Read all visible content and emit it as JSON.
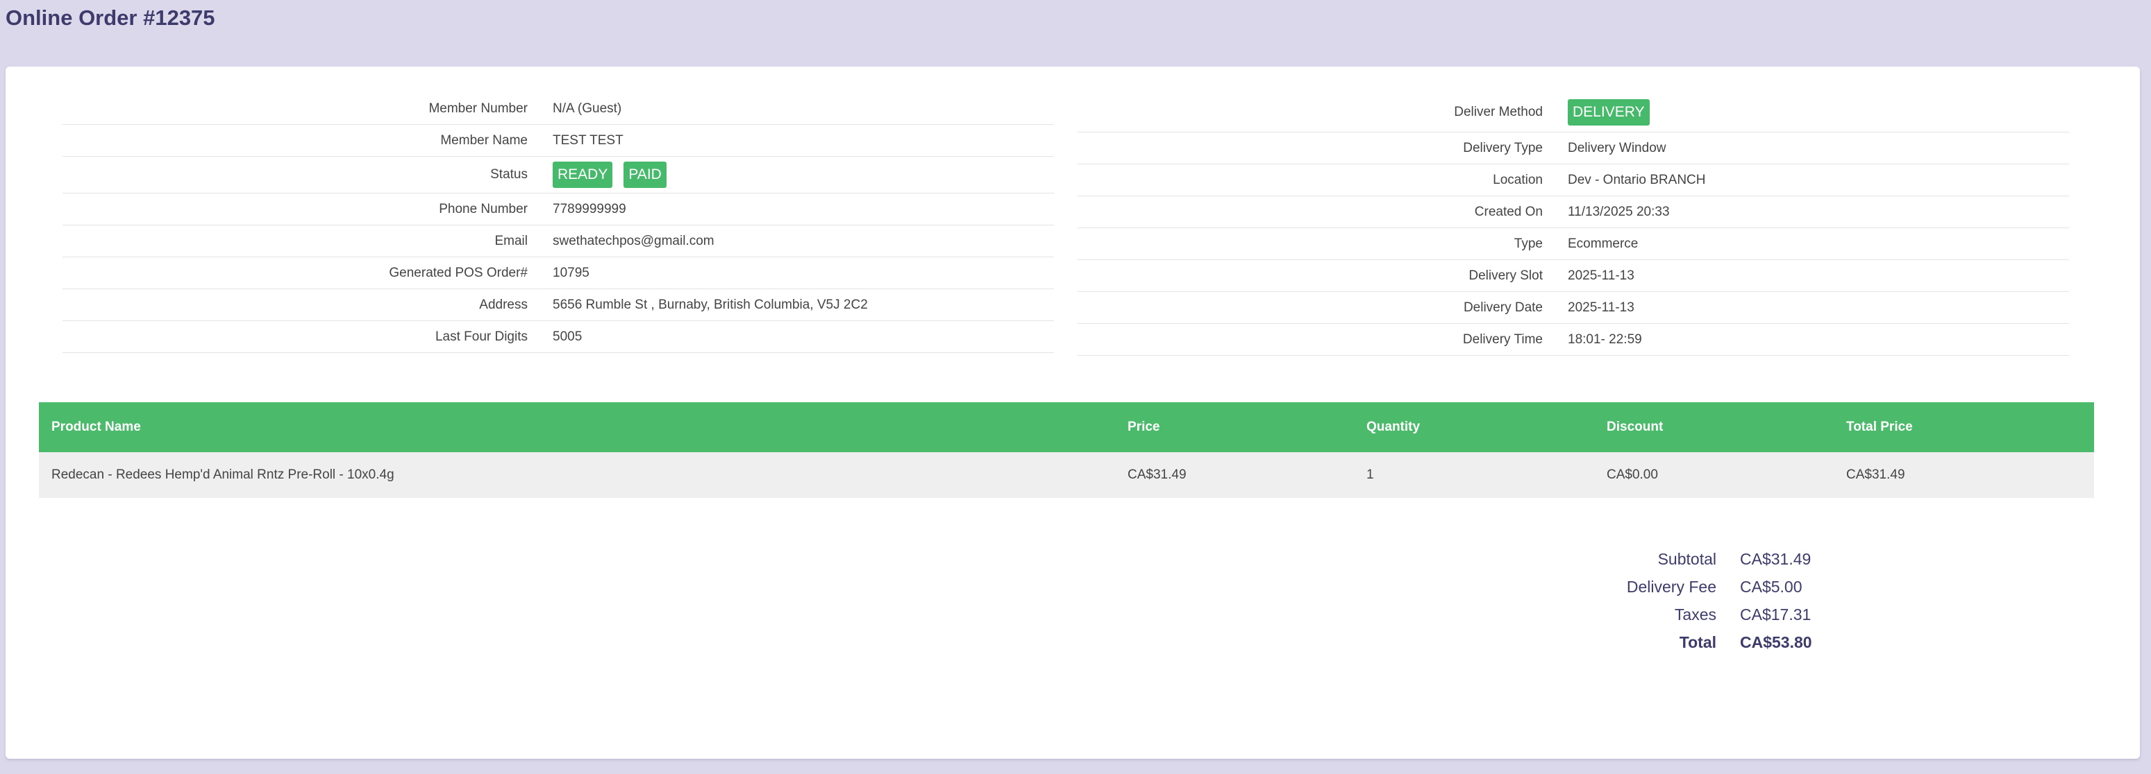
{
  "page": {
    "title": "Online Order #12375"
  },
  "left_info": [
    {
      "label": "Member Number",
      "value": "N/A (Guest)"
    },
    {
      "label": "Member Name",
      "value": "TEST TEST"
    },
    {
      "label": "Status",
      "badges": [
        "READY",
        "PAID"
      ]
    },
    {
      "label": "Phone Number",
      "value": "7789999999"
    },
    {
      "label": "Email",
      "value": "swethatechpos@gmail.com"
    },
    {
      "label": "Generated POS Order#",
      "value": "10795"
    },
    {
      "label": "Address",
      "value": "5656 Rumble St , Burnaby, British Columbia, V5J 2C2"
    },
    {
      "label": "Last Four Digits",
      "value": "5005"
    }
  ],
  "right_info": [
    {
      "label": "Deliver Method",
      "badge": "DELIVERY"
    },
    {
      "label": "Delivery Type",
      "value": "Delivery Window"
    },
    {
      "label": "Location",
      "value": "Dev - Ontario BRANCH"
    },
    {
      "label": "Created On",
      "value": "11/13/2025 20:33"
    },
    {
      "label": "Type",
      "value": "Ecommerce"
    },
    {
      "label": "Delivery Slot",
      "value": "2025-11-13"
    },
    {
      "label": "Delivery Date",
      "value": "2025-11-13"
    },
    {
      "label": "Delivery Time",
      "value": "18:01- 22:59"
    }
  ],
  "items_table": {
    "headers": [
      "Product Name",
      "Price",
      "Quantity",
      "Discount",
      "Total Price"
    ],
    "rows": [
      [
        "Redecan - Redees Hemp'd Animal Rntz Pre-Roll - 10x0.4g",
        "CA$31.49",
        "1",
        "CA$0.00",
        "CA$31.49"
      ]
    ]
  },
  "totals": [
    {
      "label": "Subtotal",
      "value": "CA$31.49"
    },
    {
      "label": "Delivery Fee",
      "value": "CA$5.00"
    },
    {
      "label": "Taxes",
      "value": "CA$17.31"
    },
    {
      "label": "Total",
      "value": "CA$53.80"
    }
  ],
  "colors": {
    "accent": "#4bbb6b",
    "page_bg": "#dcd8ec",
    "title": "#3d3b6b"
  }
}
